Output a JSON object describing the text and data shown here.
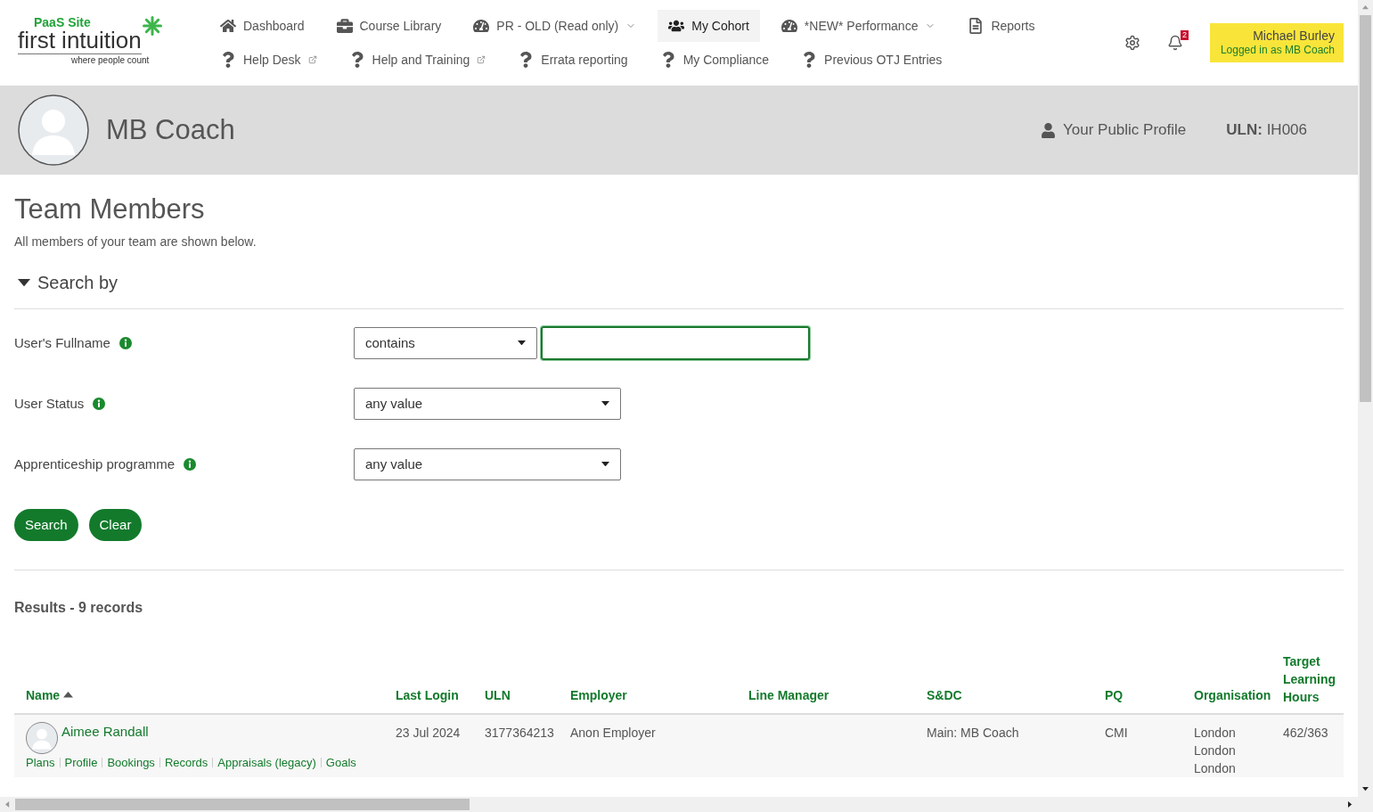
{
  "logo": {
    "site_label": "PaaS Site",
    "brand": "first intuition",
    "tagline": "where people count"
  },
  "nav": {
    "rows": [
      [
        {
          "label": "Dashboard",
          "selected": false,
          "dropdown": false,
          "external": false
        },
        {
          "label": "Course Library",
          "selected": false,
          "dropdown": false,
          "external": false
        },
        {
          "label": "PR - OLD (Read only)",
          "selected": false,
          "dropdown": true,
          "external": false
        },
        {
          "label": "My Cohort",
          "selected": true,
          "dropdown": false,
          "external": false
        },
        {
          "label": "*NEW* Performance",
          "selected": false,
          "dropdown": true,
          "external": false
        },
        {
          "label": "Reports",
          "selected": false,
          "dropdown": false,
          "external": false
        }
      ],
      [
        {
          "label": "Help Desk",
          "selected": false,
          "dropdown": false,
          "external": true
        },
        {
          "label": "Help and Training",
          "selected": false,
          "dropdown": false,
          "external": true
        },
        {
          "label": "Errata reporting",
          "selected": false,
          "dropdown": false,
          "external": false
        },
        {
          "label": "My Compliance",
          "selected": false,
          "dropdown": false,
          "external": false
        },
        {
          "label": "Previous OTJ Entries",
          "selected": false,
          "dropdown": false,
          "external": false
        }
      ]
    ]
  },
  "notifications": {
    "count": "2"
  },
  "user": {
    "name": "Michael Burley",
    "role_text": "Logged in as MB Coach"
  },
  "profile": {
    "name": "MB Coach",
    "public_profile_link": "Your Public Profile",
    "uln_label": "ULN:",
    "uln_value": "IH006"
  },
  "page": {
    "title": "Team Members",
    "subtitle": "All members of your team are shown below."
  },
  "search": {
    "heading": "Search by",
    "expanded": true,
    "fields": [
      {
        "label": "User's Fullname",
        "kind": "text",
        "operator": "contains",
        "focused": true
      },
      {
        "label": "User Status",
        "kind": "select",
        "value": "any value"
      },
      {
        "label": "Apprenticeship programme",
        "kind": "select",
        "value": "any value"
      }
    ],
    "buttons": [
      "Search",
      "Clear"
    ]
  },
  "results": {
    "summary": "Results - 9 records",
    "columns": [
      {
        "label": "Name",
        "sorted": true
      },
      {
        "label": "Last Login",
        "sorted": false
      },
      {
        "label": "ULN",
        "sorted": false
      },
      {
        "label": "Employer",
        "sorted": false
      },
      {
        "label": "Line Manager",
        "sorted": false
      },
      {
        "label": "S&DC",
        "sorted": false
      },
      {
        "label": "PQ",
        "sorted": false
      },
      {
        "label": "Organisation",
        "sorted": false
      },
      {
        "label": "Target Learning Hours",
        "sorted": false
      }
    ],
    "rows": [
      {
        "name": "Aimee Randall",
        "links": [
          "Plans",
          "Profile",
          "Bookings",
          "Records",
          "Appraisals (legacy)",
          "Goals"
        ],
        "last_login": "23 Jul 2024",
        "uln": "3177364213",
        "employer": "Anon Employer",
        "sdc": "Main: MB Coach",
        "pq": "CMI",
        "organisation": [
          "London",
          "London",
          "London"
        ],
        "target_hours": "462/363"
      }
    ]
  }
}
